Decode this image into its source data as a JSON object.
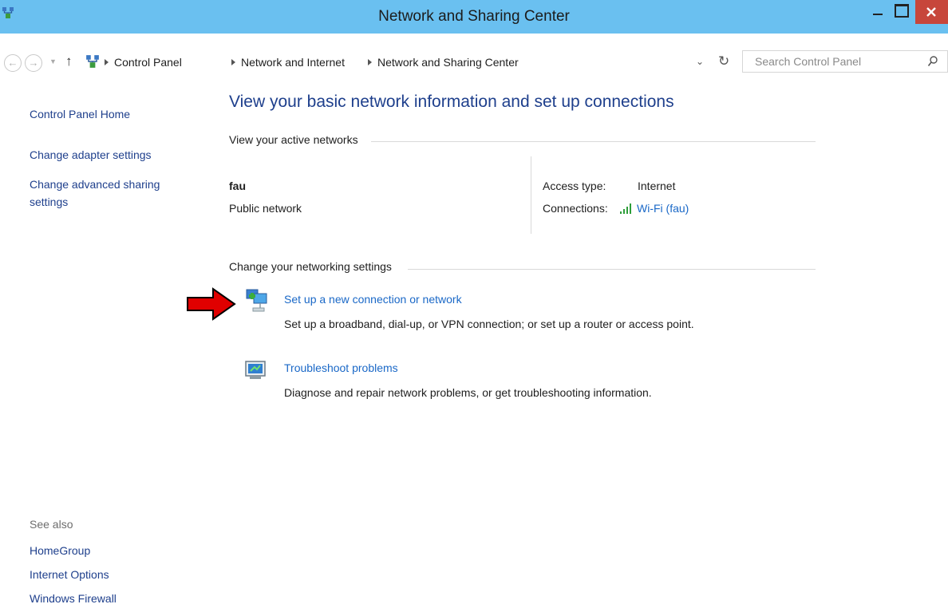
{
  "window": {
    "title": "Network and Sharing Center",
    "close_symbol": "×"
  },
  "address_bar": {
    "breadcrumbs": [
      "Control Panel",
      "Network and Internet",
      "Network and Sharing Center"
    ],
    "search_placeholder": "Search Control Panel"
  },
  "left_nav": {
    "home": "Control Panel Home",
    "adapter": "Change adapter settings",
    "sharing_line1": "Change advanced sharing",
    "sharing_line2": "settings",
    "see_also_label": "See also",
    "see_also": [
      "HomeGroup",
      "Internet Options",
      "Windows Firewall"
    ]
  },
  "main": {
    "heading": "View your basic network information and set up connections",
    "active_networks_label": "View your active networks",
    "network": {
      "name": "fau",
      "type": "Public network",
      "access_type_label": "Access type:",
      "access_type_value": "Internet",
      "connections_label": "Connections:",
      "connection_link": "Wi-Fi (fau)"
    },
    "change_settings_label": "Change your networking settings",
    "tasks": [
      {
        "link": "Set up a new connection or network",
        "description": "Set up a broadband, dial-up, or VPN connection; or set up a router or access point."
      },
      {
        "link": "Troubleshoot problems",
        "description": "Diagnose and repair network problems, or get troubleshooting information."
      }
    ]
  },
  "icons": {
    "app": "network-center-icon",
    "back": "back-arrow-icon",
    "forward": "forward-arrow-icon",
    "up": "up-arrow-icon",
    "refresh": "refresh-icon",
    "search": "search-icon",
    "wifi": "wifi-signal-icon",
    "new_connection": "new-connection-icon",
    "troubleshoot": "troubleshoot-icon",
    "annotation": "red-arrow-icon"
  },
  "colors": {
    "titlebar": "#6ac0f0",
    "close_button": "#c7463b",
    "heading": "#1e3f8c",
    "link": "#1a68c7",
    "wifi": "#2e9e3a",
    "arrow": "#e00000"
  }
}
